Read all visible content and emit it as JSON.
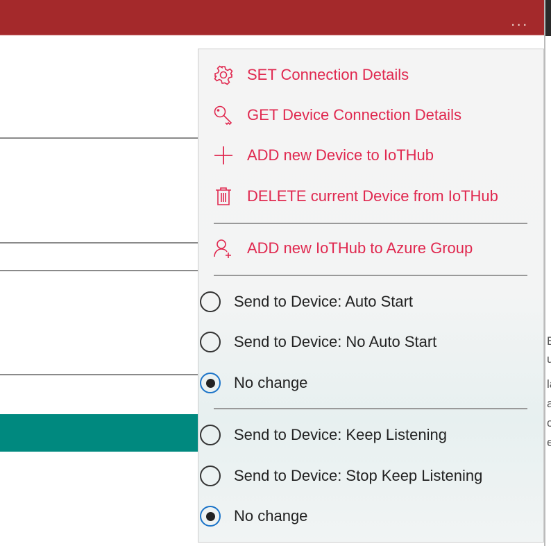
{
  "header": {
    "more_label": "..."
  },
  "menu": {
    "commands": [
      {
        "icon": "gear-icon",
        "label": "SET Connection Details"
      },
      {
        "icon": "key-icon",
        "label": "GET Device Connection Details"
      },
      {
        "icon": "plus-icon",
        "label": "ADD new Device to IoTHub"
      },
      {
        "icon": "trash-icon",
        "label": "DELETE current Device from IoTHub"
      },
      {
        "icon": "add-person-icon",
        "label": "ADD new IoTHub to Azure Group"
      }
    ],
    "autostart_options": [
      {
        "label": "Send to Device: Auto Start",
        "selected": false
      },
      {
        "label": "Send to Device: No Auto Start",
        "selected": false
      },
      {
        "label": "No change",
        "selected": true
      }
    ],
    "listening_options": [
      {
        "label": "Send to Device: Keep Listening",
        "selected": false
      },
      {
        "label": "Send to Device: Stop Keep Listening",
        "selected": false
      },
      {
        "label": "No change",
        "selected": true
      }
    ]
  },
  "background_text": [
    "Be",
    "u",
    "la",
    "ar",
    "c",
    "es"
  ],
  "colors": {
    "header": "#a4292b",
    "accent": "#e0284f",
    "teal": "#00897f",
    "radio_selected": "#1a73c8"
  }
}
